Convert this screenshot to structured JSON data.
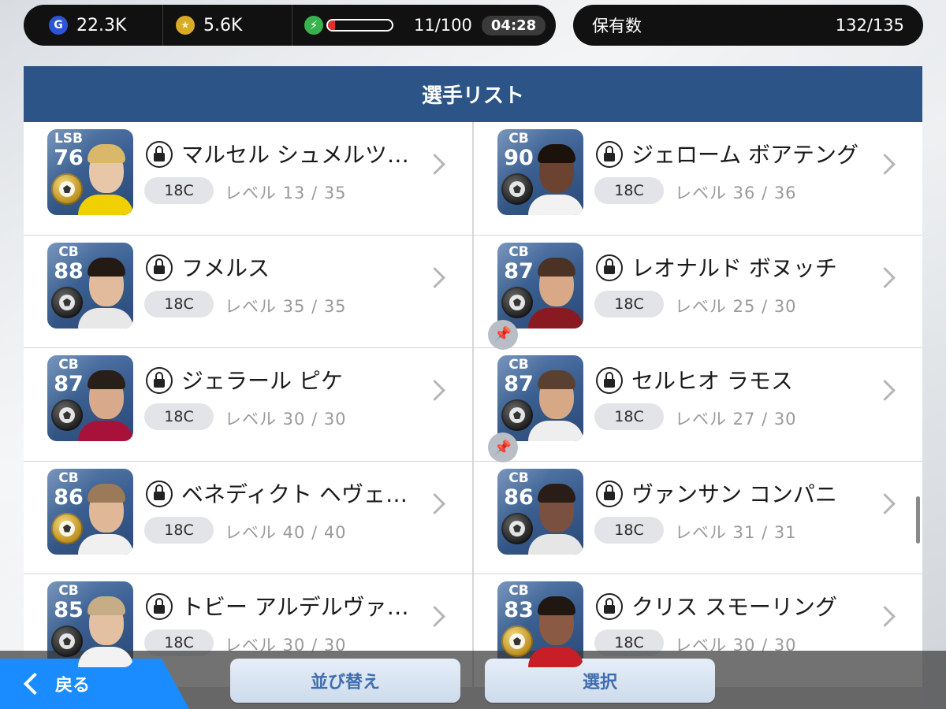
{
  "status_bar": {
    "gp": "22.3K",
    "coins": "5.6K",
    "energy_fraction": 0.11,
    "energy": "11/100",
    "timer": "04:28",
    "owned_label": "保有数",
    "owned_value": "132/135"
  },
  "panel": {
    "title": "選手リスト"
  },
  "players": [
    {
      "pos": "LSB",
      "ovr": "76",
      "name": "マルセル シュメルツ…",
      "cost": "18C",
      "level": "レベル 13 / 35",
      "badge": "gold",
      "pinned": false,
      "skin": "#e8c6a8",
      "hair": "#d9b86a",
      "shirt": "#f0d000"
    },
    {
      "pos": "CB",
      "ovr": "90",
      "name": "ジェローム ボアテング",
      "cost": "18C",
      "level": "レベル 36 / 36",
      "badge": "black",
      "pinned": false,
      "skin": "#6b4330",
      "hair": "#1c120c",
      "shirt": "#f2f2f2"
    },
    {
      "pos": "CB",
      "ovr": "88",
      "name": "フメルス",
      "cost": "18C",
      "level": "レベル 35 / 35",
      "badge": "black",
      "pinned": false,
      "skin": "#e2bb9c",
      "hair": "#241a14",
      "shirt": "#e8e8e8"
    },
    {
      "pos": "CB",
      "ovr": "87",
      "name": "レオナルド ボヌッチ",
      "cost": "18C",
      "level": "レベル 25 / 30",
      "badge": "black",
      "pinned": true,
      "skin": "#d9a887",
      "hair": "#4a3224",
      "shirt": "#8a1a22"
    },
    {
      "pos": "CB",
      "ovr": "87",
      "name": "ジェラール ピケ",
      "cost": "18C",
      "level": "レベル 30 / 30",
      "badge": "black",
      "pinned": false,
      "skin": "#d8a98a",
      "hair": "#2a1e18",
      "shirt": "#a8123a"
    },
    {
      "pos": "CB",
      "ovr": "87",
      "name": "セルヒオ ラモス",
      "cost": "18C",
      "level": "レベル 27 / 30",
      "badge": "black",
      "pinned": true,
      "skin": "#d6a886",
      "hair": "#5a4030",
      "shirt": "#eeeeee"
    },
    {
      "pos": "CB",
      "ovr": "86",
      "name": "ベネディクト ヘヴェ…",
      "cost": "18C",
      "level": "レベル 40 / 40",
      "badge": "gold",
      "pinned": false,
      "skin": "#e0b898",
      "hair": "#9a7a58",
      "shirt": "#f0f0f0"
    },
    {
      "pos": "CB",
      "ovr": "86",
      "name": "ヴァンサン コンパニ",
      "cost": "18C",
      "level": "レベル 31 / 31",
      "badge": "black",
      "pinned": false,
      "skin": "#7a5040",
      "hair": "#2a1c16",
      "shirt": "#e6e6e6"
    },
    {
      "pos": "CB",
      "ovr": "85",
      "name": "トビー アルデルヴァ…",
      "cost": "18C",
      "level": "レベル 30 / 30",
      "badge": "black",
      "pinned": false,
      "skin": "#e4c0a2",
      "hair": "#c7ad86",
      "shirt": "#f2f2f2"
    },
    {
      "pos": "CB",
      "ovr": "83",
      "name": "クリス スモーリング",
      "cost": "18C",
      "level": "レベル 30 / 30",
      "badge": "gold",
      "pinned": false,
      "skin": "#8a5a44",
      "hair": "#201612",
      "shirt": "#c81e28"
    }
  ],
  "bottom_bar": {
    "back_label": "戻る",
    "sort_label": "並び替え",
    "select_label": "選択"
  },
  "colors": {
    "header": "#2d5486",
    "back_button": "#1a8cff",
    "card_bg": "#3a5f90"
  }
}
